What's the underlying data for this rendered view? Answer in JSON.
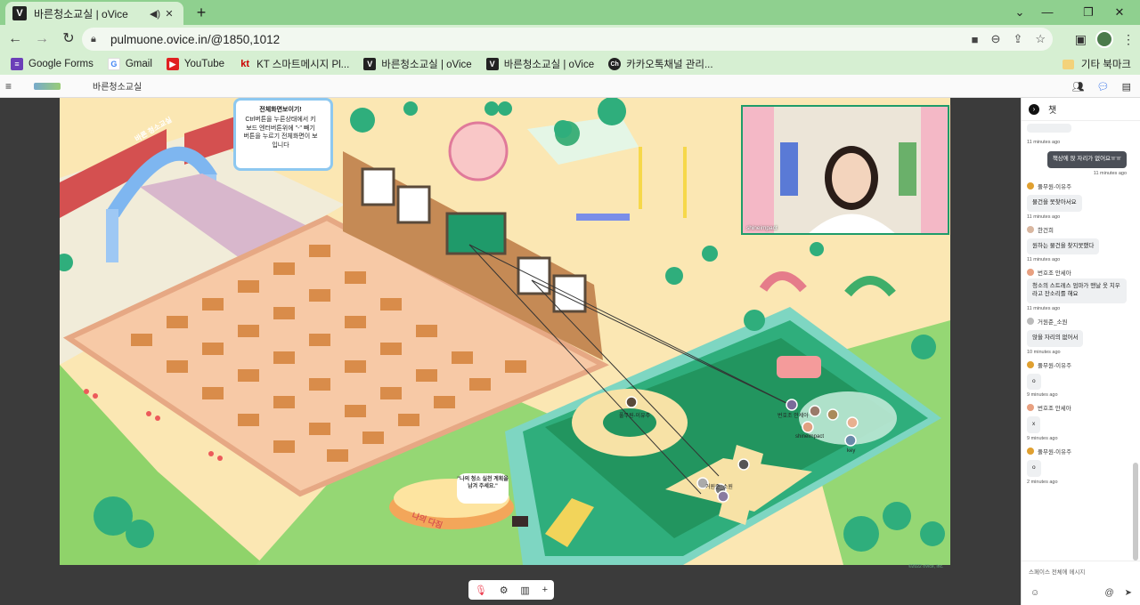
{
  "browser": {
    "tab_title": "바른청소교실 | oVice",
    "tab_favicon": "V",
    "url": "pulmuone.ovice.in/@1850,1012",
    "window_controls": [
      "minimize",
      "maximize",
      "close"
    ]
  },
  "bookmarks": [
    {
      "label": "Google Forms",
      "icon": "forms-icon",
      "color": "#6b3fb8"
    },
    {
      "label": "Gmail",
      "icon": "google-icon",
      "color": "#ffffff"
    },
    {
      "label": "YouTube",
      "icon": "youtube-icon",
      "color": "#e02020"
    },
    {
      "label": "KT 스마트메시지 Pl...",
      "icon": "kt-icon",
      "color": "#d6efd2"
    },
    {
      "label": "바른청소교실 | oVice",
      "icon": "ovice-icon",
      "color": "#222222"
    },
    {
      "label": "바른청소교실 | oVice",
      "icon": "ovice-icon",
      "color": "#222222"
    },
    {
      "label": "카카오톡채널 관리...",
      "icon": "kakao-icon",
      "color": "#222222"
    }
  ],
  "bookmarks_other": "기타 북마크",
  "app": {
    "space_name": "바른청소교실"
  },
  "map": {
    "notice_title": "전체화면보이기!",
    "notice_body": "Ctrl버튼을 누른상태에서 키보드 엔터버튼위에 \"-\" 빼기 버튼을 누르기 전체화면이 보입니다",
    "gate_sign": "바른 청소교실",
    "stage_sign": "나의 다짐",
    "speech_bubble": "\"나의 청소 실천 계획을 남겨 주세요.\"",
    "video_user": "shineimpact",
    "user_labels": [
      "풀무원-이유주",
      "shineimpact",
      "key",
      "번호조 안세아",
      "거원준_소원"
    ],
    "copyright": "©2022 oVice, Inc."
  },
  "chat": {
    "title": "챗",
    "messages": [
      {
        "sender": "",
        "text": "",
        "time": "11 minutes ago",
        "mine": false,
        "partial": true
      },
      {
        "sender": "",
        "text": "책상에 앉 자리가 없어요ㅠㅠ",
        "time": "11 minutes ago",
        "mine": true
      },
      {
        "sender": "풀무원-이유주",
        "text": "물건을 못찾아서요",
        "time": "11 minutes ago",
        "avatar": "#e0a030"
      },
      {
        "sender": "한건희",
        "text": "원하는 물건을 찾지못했다",
        "time": "11 minutes ago",
        "avatar": "#d9b7a0"
      },
      {
        "sender": "번호조 안세아",
        "text": "청소의 스트레스 엄마가 맨날 옷 치우라고 잔소리를 해요",
        "time": "11 minutes ago",
        "avatar": "#e8a080"
      },
      {
        "sender": "거원준_소원",
        "text": "앉을 자리의 없어서",
        "time": "10 minutes ago",
        "avatar": "#bbbbbb"
      },
      {
        "sender": "풀무원-이유주",
        "text": "o",
        "time": "9 minutes ago",
        "avatar": "#e0a030"
      },
      {
        "sender": "번호조 안세아",
        "text": "x",
        "time": "9 minutes ago",
        "avatar": "#e8a080"
      },
      {
        "sender": "풀무원-이유주",
        "text": "o",
        "time": "2 minutes ago",
        "avatar": "#e0a030"
      }
    ],
    "input_placeholder": "스페이스 전체에 메시지"
  },
  "colors": {
    "browser_frame": "#8fd08f",
    "toolbar": "#d6efd2",
    "accent": "#2a6be8",
    "map_green": "#2fae7c"
  }
}
